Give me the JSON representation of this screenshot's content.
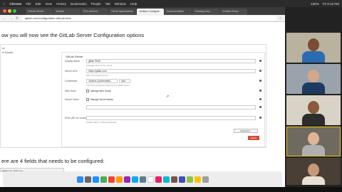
{
  "menubar": {
    "app": "Chrome",
    "items": [
      "File",
      "Edit",
      "View",
      "History",
      "Bookmarks",
      "People",
      "Tab",
      "Window",
      "Help"
    ],
    "right": [
      "100%",
      "Fri 8:15 PM"
    ]
  },
  "browser": {
    "tabs": [
      "GitLab OAuth...",
      "Jenkins",
      "Run Jenkins...",
      "OAuth Applications",
      "Jenkins Configure",
      "Documentation",
      "Creating new...",
      "Jenkins Setup"
    ],
    "url": "gitlab.com/configuration-with-jenkins"
  },
  "article": {
    "heading_top": "ow you will now see the GitLab Server Configuration options",
    "heading_bottom": "ere are 4 fields that needs to be configured:"
  },
  "screenshot": {
    "leftnav": [
      "ve",
      "ts Header"
    ],
    "panel_title": "GitLab Server",
    "rows": [
      {
        "label": "Display Name",
        "value": "gitlab 9049",
        "help": "A display name for the server"
      },
      {
        "label": "Server URL",
        "value": "https://gitlab.com",
        "help": "URL of the GitLab server"
      },
      {
        "label": "Credentials",
        "value": "- none -",
        "help": "The Personal Access Token for the GitLab server"
      },
      {
        "label": "Web Hook",
        "value": "",
        "help": ""
      },
      {
        "label": "Secret Token",
        "value": "",
        "help": ""
      },
      {
        "label": "Root URL for hooks",
        "value": "",
        "help": "Jenkins URL for GitLab webhooks"
      }
    ],
    "credentials_select": "Jenkins (credentials)",
    "add_label": "Add",
    "web_hook_checkbox": "Manage Web Hooks",
    "secret_checkbox": "Manage Secret Values",
    "advanced_button": "Advanced...",
    "delete_button": "Delete"
  },
  "statusbar": "Waiting for gitlab.com...",
  "participants": 5
}
